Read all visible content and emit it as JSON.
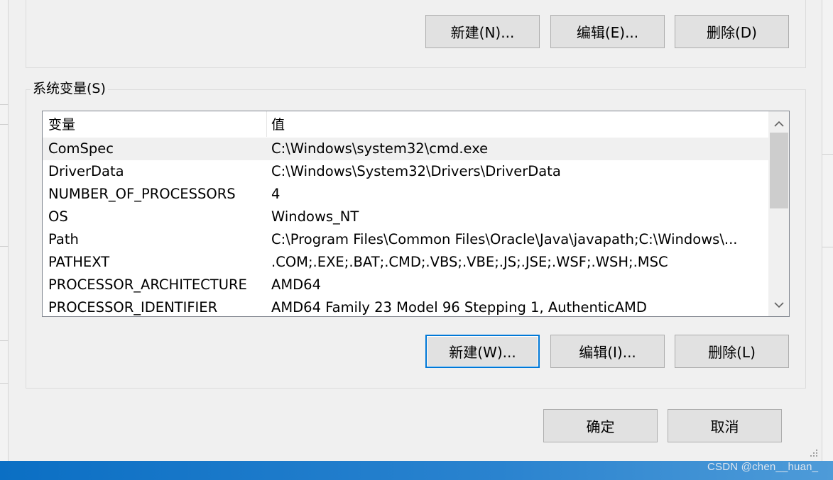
{
  "user_vars": {
    "buttons": {
      "new": "新建(N)...",
      "edit": "编辑(E)...",
      "delete": "删除(D)"
    }
  },
  "system_vars": {
    "title": "系统变量(S)",
    "columns": {
      "name": "变量",
      "value": "值"
    },
    "rows": [
      {
        "name": "ComSpec",
        "value": "C:\\Windows\\system32\\cmd.exe"
      },
      {
        "name": "DriverData",
        "value": "C:\\Windows\\System32\\Drivers\\DriverData"
      },
      {
        "name": "NUMBER_OF_PROCESSORS",
        "value": "4"
      },
      {
        "name": "OS",
        "value": "Windows_NT"
      },
      {
        "name": "Path",
        "value": "C:\\Program Files\\Common Files\\Oracle\\Java\\javapath;C:\\Windows\\..."
      },
      {
        "name": "PATHEXT",
        "value": ".COM;.EXE;.BAT;.CMD;.VBS;.VBE;.JS;.JSE;.WSF;.WSH;.MSC"
      },
      {
        "name": "PROCESSOR_ARCHITECTURE",
        "value": "AMD64"
      },
      {
        "name": "PROCESSOR_IDENTIFIER",
        "value": "AMD64 Family 23 Model 96 Stepping 1, AuthenticAMD"
      }
    ],
    "selected_row": "ComSpec",
    "buttons": {
      "new": "新建(W)...",
      "edit": "编辑(I)...",
      "delete": "删除(L)"
    }
  },
  "dialog_buttons": {
    "ok": "确定",
    "cancel": "取消"
  },
  "watermark": "CSDN @chen__huan_",
  "colors": {
    "focus": "#0078d7",
    "button_bg": "#e1e1e1",
    "dialog_bg": "#f0f0f0"
  }
}
